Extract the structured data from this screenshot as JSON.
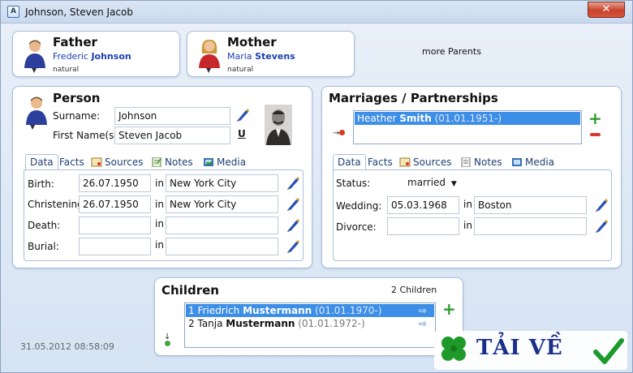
{
  "window": {
    "title": "Johnson, Steven Jacob",
    "close": "✕"
  },
  "father": {
    "heading": "Father",
    "first": "Frederic",
    "last": "Johnson",
    "relation": "natural"
  },
  "mother": {
    "heading": "Mother",
    "first": "Maria",
    "last": "Stevens",
    "relation": "natural"
  },
  "more_parents": "more Parents",
  "person": {
    "heading": "Person",
    "surname_label": "Surname:",
    "surname": "Johnson",
    "firstname_label": "First Name(s):",
    "firstname": "Steven Jacob",
    "underline_glyph": "U",
    "tabs": [
      "Data",
      "Facts",
      "Sources",
      "Notes",
      "Media"
    ],
    "events": [
      {
        "label": "Birth:",
        "date": "26.07.1950",
        "in": "in",
        "place": "New York City"
      },
      {
        "label": "Christening:",
        "date": "26.07.1950",
        "in": "in",
        "place": "New York City"
      },
      {
        "label": "Death:",
        "date": "",
        "in": "in",
        "place": ""
      },
      {
        "label": "Burial:",
        "date": "",
        "in": "in",
        "place": ""
      }
    ]
  },
  "marriages": {
    "heading": "Marriages / Partnerships",
    "selected_first": "Heather",
    "selected_last": "Smith",
    "selected_date": "(01.01.1951-)",
    "tabs": [
      "Data",
      "Facts",
      "Sources",
      "Notes",
      "Media"
    ],
    "status_label": "Status:",
    "status_value": "married",
    "wedding_label": "Wedding:",
    "wedding_date": "05.03.1968",
    "wedding_in": "in",
    "wedding_place": "Boston",
    "divorce_label": "Divorce:",
    "divorce_in": "in"
  },
  "children": {
    "heading": "Children",
    "count": "2 Children",
    "items": [
      {
        "num": "1",
        "first": "Friedrich",
        "last": "Mustermann",
        "date": "(01.01.1970-)"
      },
      {
        "num": "2",
        "first": "Tanja",
        "last": "Mustermann",
        "date": "(01.01.1972-)"
      }
    ]
  },
  "status_timestamp": "31.05.2012 08:58:09",
  "watermark": {
    "text": "TẢI VỀ"
  },
  "colors": {
    "accent": "#1a3fb0",
    "selection": "#3d8ee6",
    "close": "#c7432b",
    "add": "#2f9a2f",
    "remove": "#d9362b"
  }
}
